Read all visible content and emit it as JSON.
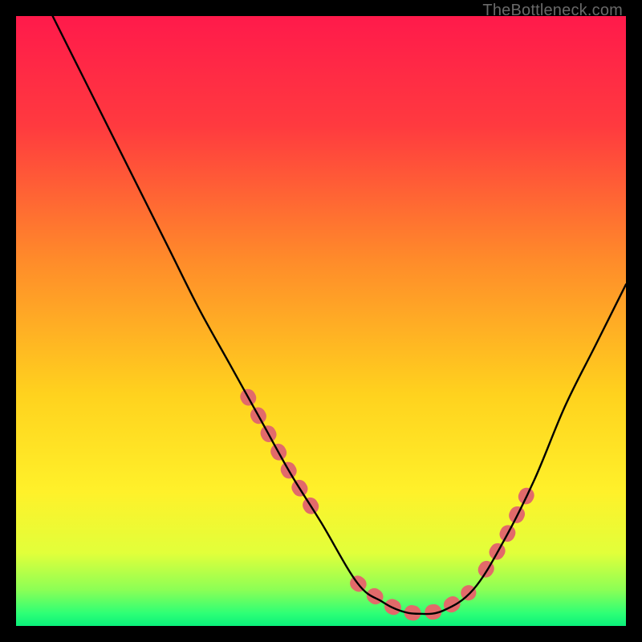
{
  "watermark": "TheBottleneck.com",
  "chart_data": {
    "type": "line",
    "title": "",
    "xlabel": "",
    "ylabel": "",
    "xlim": [
      0,
      100
    ],
    "ylim": [
      0,
      100
    ],
    "grid": false,
    "legend": false,
    "series": [
      {
        "name": "curve",
        "x": [
          6,
          10,
          15,
          20,
          25,
          30,
          35,
          40,
          45,
          50,
          56,
          60,
          63,
          66,
          70,
          75,
          80,
          85,
          90,
          95,
          100
        ],
        "values": [
          100,
          92,
          82,
          72,
          62,
          52,
          43,
          34,
          25,
          17,
          7,
          4,
          2.5,
          2,
          2.5,
          6,
          14,
          24,
          36,
          46,
          56
        ]
      }
    ],
    "highlight_segments": [
      {
        "x_start": 38,
        "x_end": 50
      },
      {
        "x_start": 56,
        "x_end": 75
      },
      {
        "x_start": 77,
        "x_end": 84
      }
    ],
    "gradient_stops": [
      {
        "pct": 0,
        "color": "#ff1a4b"
      },
      {
        "pct": 18,
        "color": "#ff3a3f"
      },
      {
        "pct": 40,
        "color": "#ff8b2a"
      },
      {
        "pct": 62,
        "color": "#ffd21e"
      },
      {
        "pct": 78,
        "color": "#fff12a"
      },
      {
        "pct": 88,
        "color": "#e2ff3a"
      },
      {
        "pct": 94,
        "color": "#8dff55"
      },
      {
        "pct": 98,
        "color": "#2cff76"
      },
      {
        "pct": 100,
        "color": "#0af07a"
      }
    ],
    "highlight_color": "#e26a6a",
    "curve_color": "#000000"
  }
}
